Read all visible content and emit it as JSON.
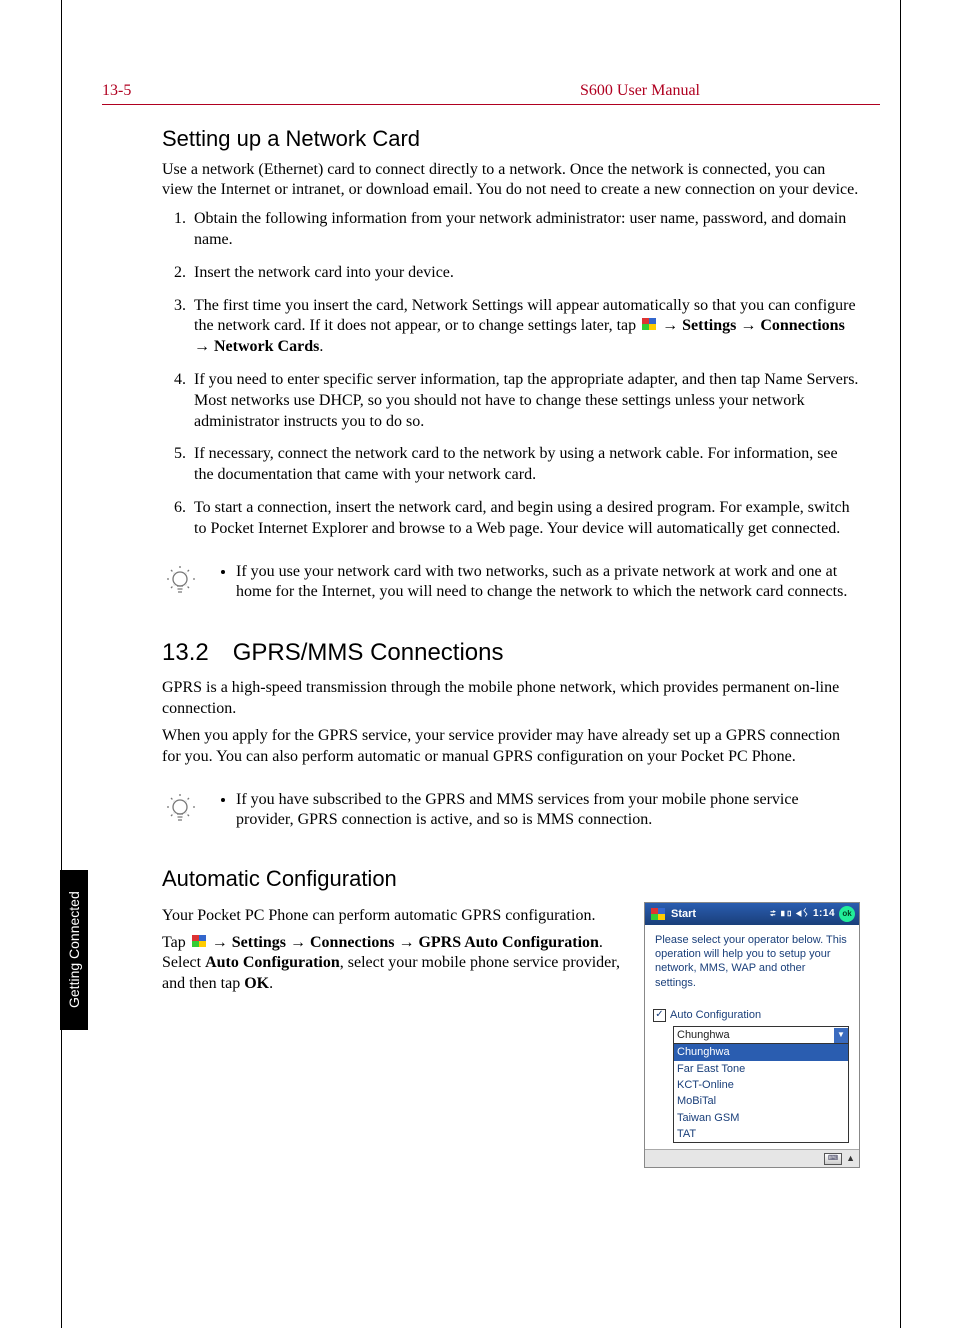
{
  "header": {
    "page_number": "13-5",
    "manual_title": "S600 User Manual"
  },
  "side_tab": "Getting Connected",
  "section_a": {
    "heading": "Setting up a Network Card",
    "intro": "Use a network (Ethernet) card to connect directly to a network. Once the network is connected, you can view the Internet or intranet, or download email. You do not need to create a new connection on your device.",
    "steps": {
      "s1": "Obtain the following information from your network administrator: user name, password, and domain name.",
      "s2": "Insert the network card into your device.",
      "s3a": "The first time you insert the card, Network Settings will appear automatically so that you can configure the network card. If it does not appear, or to change settings later, tap ",
      "s3b": " → Settings → Connections → Network Cards",
      "s3c": ".",
      "s4": "If you need to enter specific server information, tap the appropriate adapter, and then tap Name Servers. Most networks use DHCP, so you should not have to change these settings unless your network administrator instructs you to do so.",
      "s5": "If necessary, connect the network card to the network by using a network cable. For information, see the documentation that came with your network card.",
      "s6": "To start a connection, insert the network card, and begin using a desired program. For example, switch to Pocket Internet Explorer and browse to a Web page. Your device will automatically get connected."
    },
    "tip": "If you use your network card with two networks, such as a private network at work and one at home for the Internet, you will need to change the network to which the network card connects."
  },
  "section_b": {
    "number": "13.2",
    "heading": "GPRS/MMS Connections",
    "p1": "GPRS is a high-speed transmission through the mobile phone network, which provides permanent on-line connection.",
    "p2": "When you apply for the GPRS service, your service provider may have already set up a GPRS connection for you. You can also perform automatic or manual GPRS configuration on your Pocket PC Phone.",
    "tip": "If you have subscribed to the GPRS and MMS services from your mobile phone service provider, GPRS connection is active, and so is MMS connection."
  },
  "section_c": {
    "heading": "Automatic Configuration",
    "p1": "Your Pocket PC Phone can perform automatic GPRS configuration.",
    "p2a": "Tap ",
    "p2b": " → Settings → Connections → GPRS Auto Configuration",
    "p2c": ". Select ",
    "p2d": "Auto Configuration",
    "p2e": ", select your mobile phone service provider, and then tap ",
    "p2f": "OK",
    "p2g": "."
  },
  "device": {
    "start_label": "Start",
    "status_icons": "⇄ ▮▯ ◀ᛊ",
    "time": "1:14",
    "ok": "ok",
    "message": "Please select your operator below. This operation will help you to setup your network, MMS, WAP and other settings.",
    "checkbox_label": "Auto Configuration",
    "checkbox_checked": "✓",
    "selected": "Chunghwa",
    "options": {
      "o0": "Chunghwa",
      "o1": "Far East Tone",
      "o2": "KCT-Online",
      "o3": "MoBiTal",
      "o4": "Taiwan GSM",
      "o5": "TAT"
    }
  }
}
